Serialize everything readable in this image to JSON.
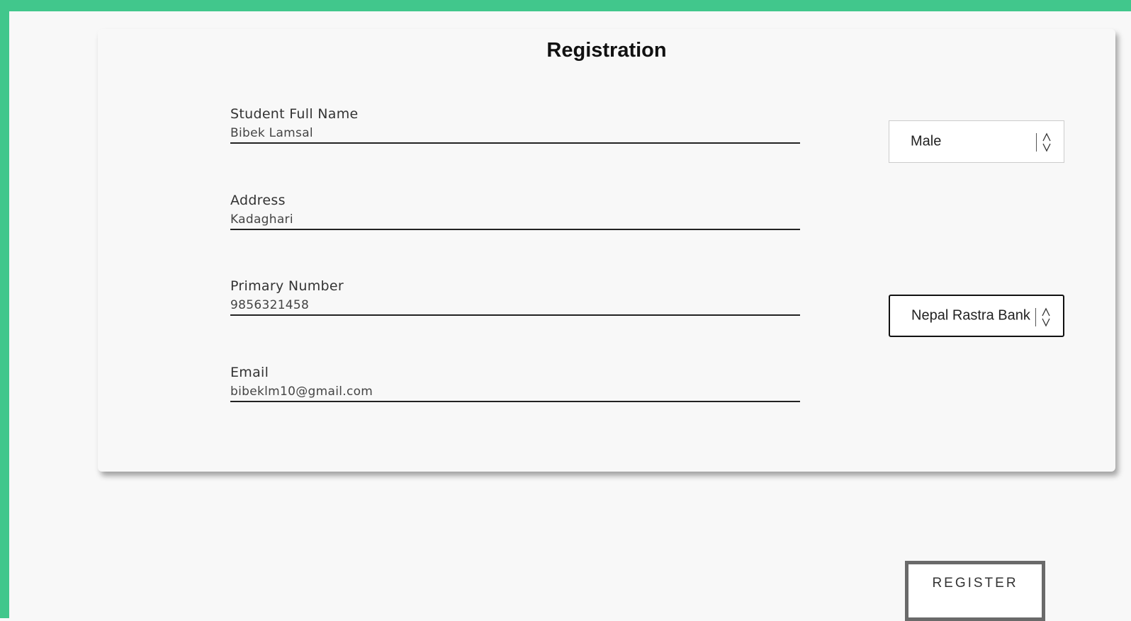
{
  "form": {
    "title": "Registration",
    "fields": [
      {
        "label": "Student Full Name",
        "value": "Bibek Lamsal"
      },
      {
        "label": "Address",
        "value": "Kadaghari"
      },
      {
        "label": "Primary Number",
        "value": "9856321458"
      },
      {
        "label": "Email",
        "value": "bibeklm10@gmail.com"
      }
    ],
    "gender_select": {
      "selected": "Male"
    },
    "bank_select": {
      "selected": "Nepal Rastra Bank"
    },
    "register_label": "REGISTER"
  },
  "colors": {
    "accent": "#41c78c",
    "background": "#f8f8f8"
  },
  "icons": {
    "select_arrow": "up-down-chevron-icon"
  }
}
